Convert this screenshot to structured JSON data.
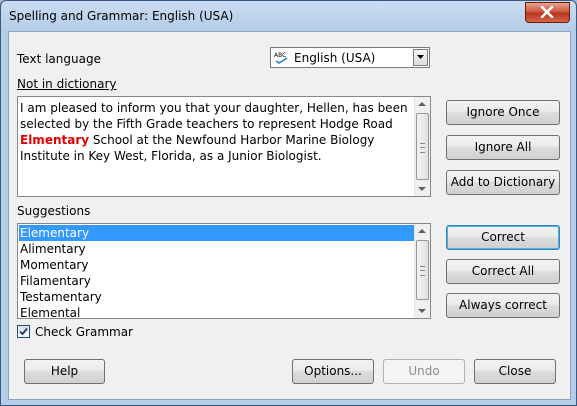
{
  "window": {
    "title": "Spelling and Grammar: English (USA)"
  },
  "text_language": {
    "label": "Text language",
    "value": "English (USA)"
  },
  "not_in_dictionary": {
    "label": "Not in dictionary",
    "text_before": "I am pleased to inform you that your daughter, Hellen, has been selected by the Fifth Grade teachers to represent Hodge Road ",
    "misspelled_word": "Elmentary",
    "text_after": " School at the Newfound Harbor Marine Biology Institute in Key West, Florida, as a Junior Biologist."
  },
  "side_buttons": {
    "ignore_once": "Ignore Once",
    "ignore_all": "Ignore All",
    "add_to_dictionary": "Add to Dictionary"
  },
  "suggestions": {
    "label": "Suggestions",
    "selected": "Elementary",
    "items": [
      "Elementary",
      "Alimentary",
      "Momentary",
      "Filamentary",
      "Testamentary",
      "Elemental"
    ]
  },
  "correct_buttons": {
    "correct": "Correct",
    "correct_all": "Correct All",
    "always_correct": "Always correct"
  },
  "check_grammar": {
    "label": "Check Grammar",
    "checked": true
  },
  "bottom_buttons": {
    "help": "Help",
    "options": "Options...",
    "undo": "Undo",
    "close": "Close"
  },
  "colors": {
    "misspelled": "#e00000",
    "selection": "#3399ff",
    "close_button": "#c75038"
  }
}
